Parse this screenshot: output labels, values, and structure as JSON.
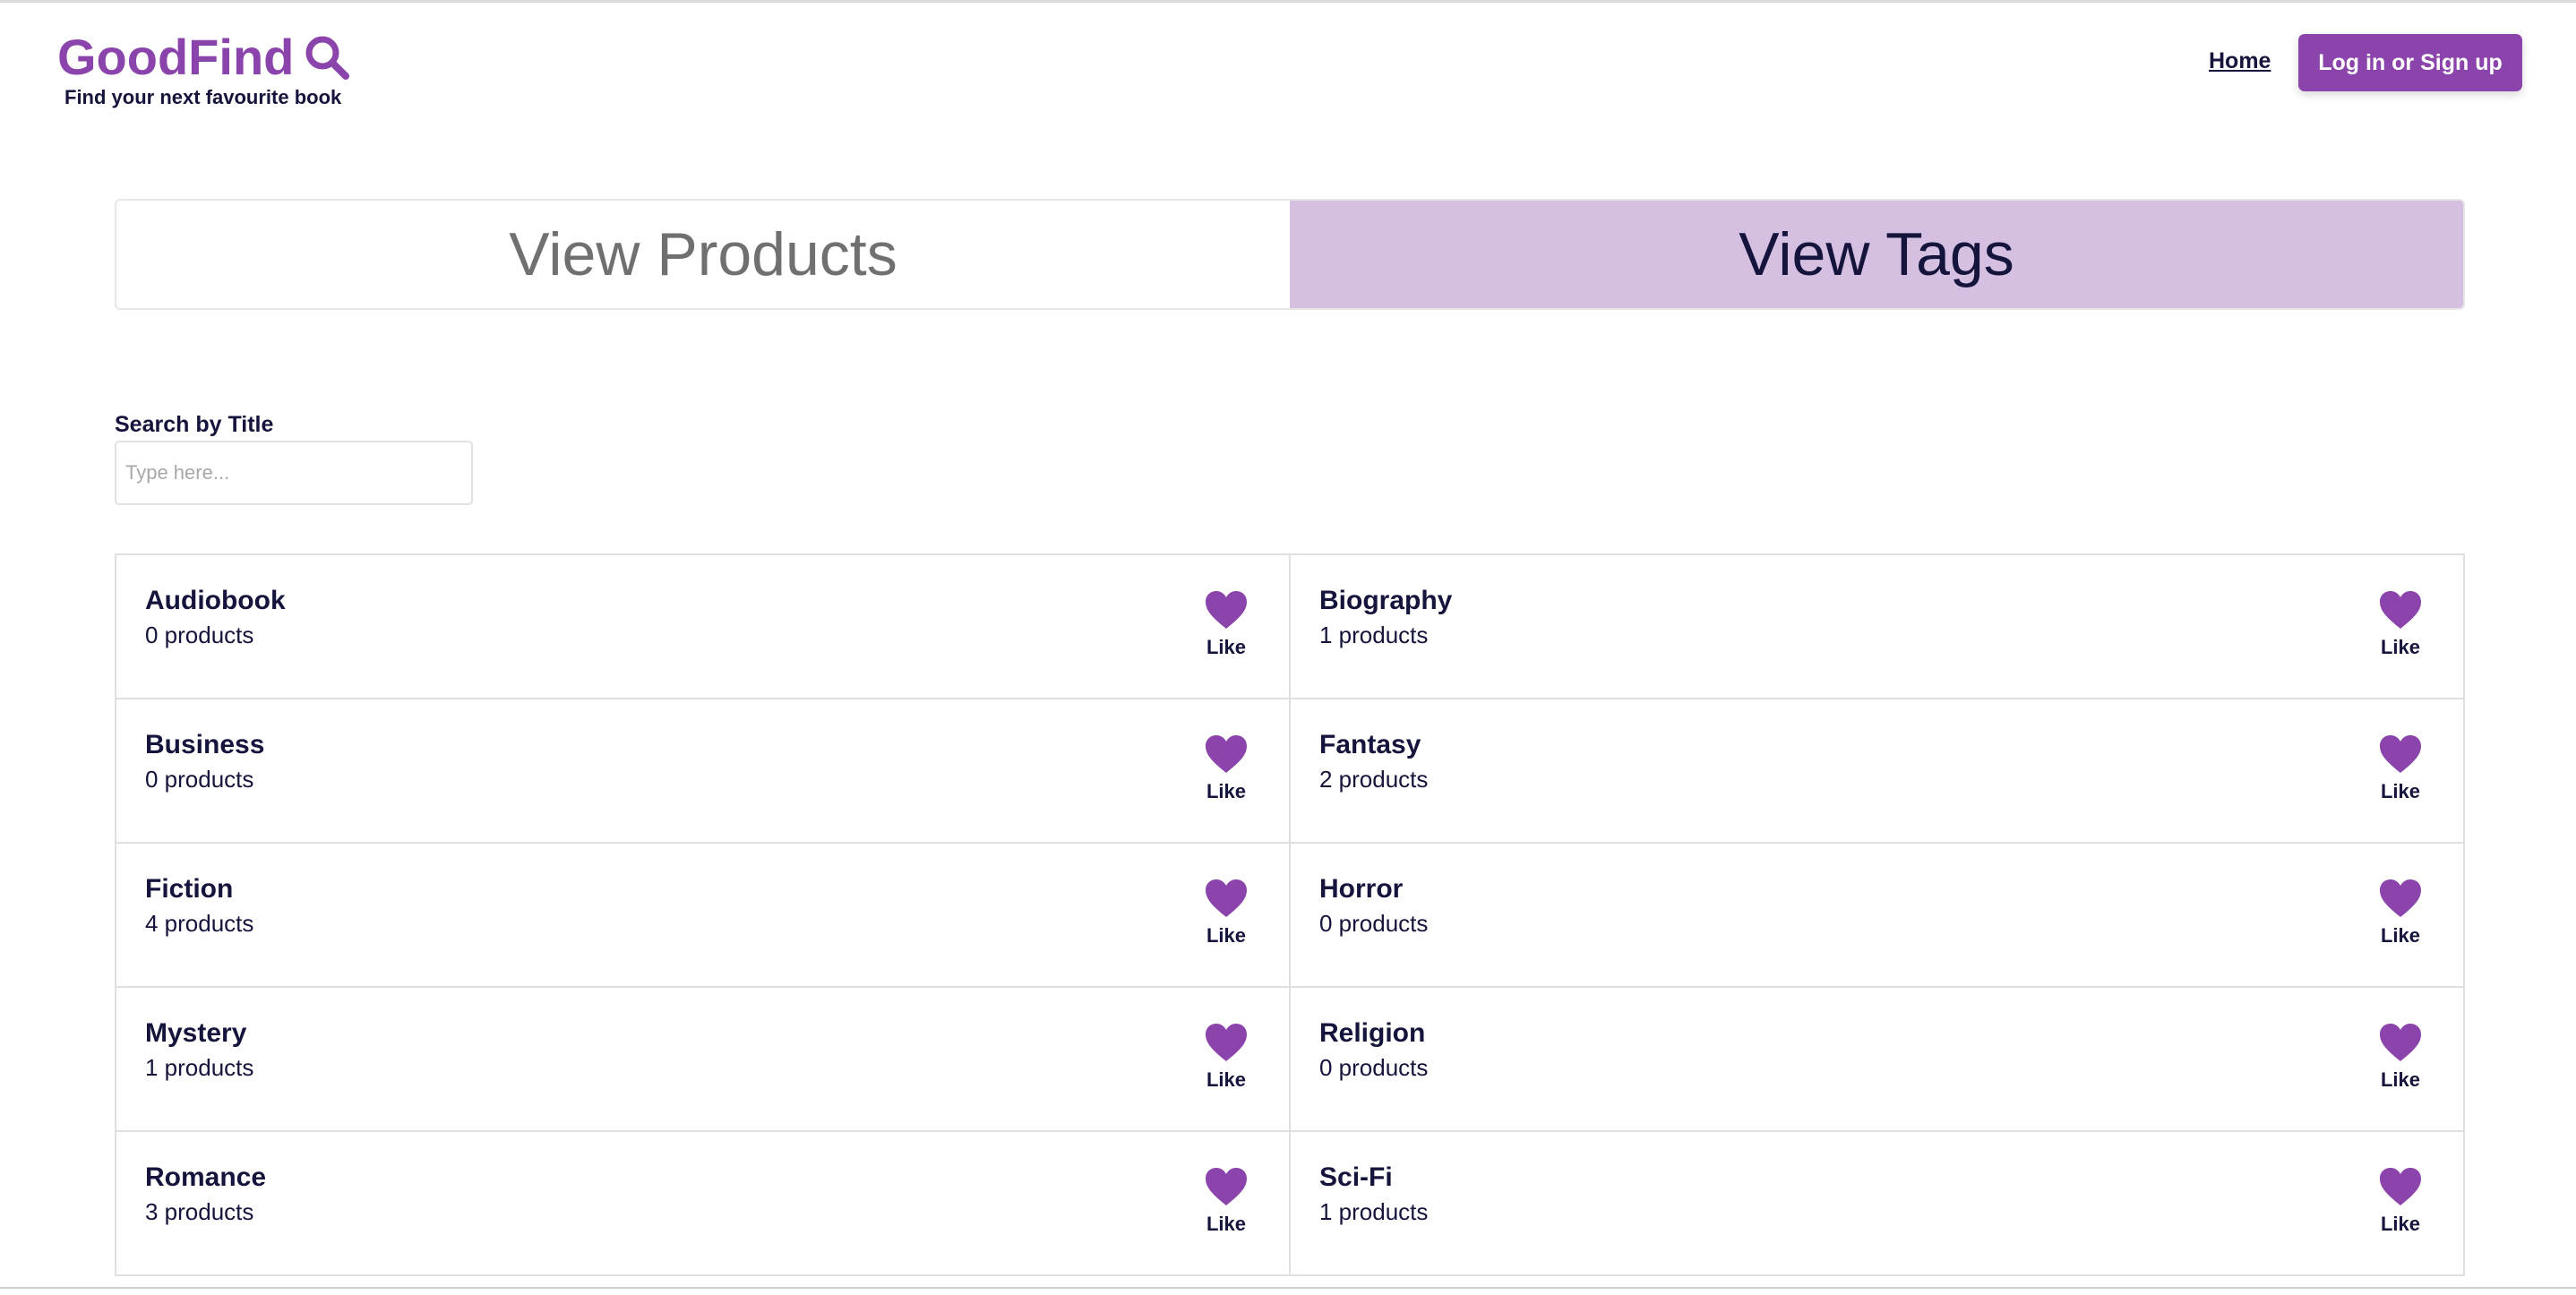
{
  "brand": {
    "name": "GoodFind",
    "tagline": "Find your next favourite book",
    "accent_color": "#8b44ac",
    "logo_icon": "search-icon"
  },
  "nav": {
    "home_label": "Home",
    "login_label": "Log in or Sign up"
  },
  "tabs": [
    {
      "label": "View Products",
      "active": false
    },
    {
      "label": "View Tags",
      "active": true
    }
  ],
  "search": {
    "label": "Search by Title",
    "placeholder": "Type here...",
    "value": ""
  },
  "tags": [
    {
      "name": "Audiobook",
      "count": "0 products",
      "like_label": "Like",
      "icon": "heart-icon"
    },
    {
      "name": "Biography",
      "count": "1 products",
      "like_label": "Like",
      "icon": "heart-icon"
    },
    {
      "name": "Business",
      "count": "0 products",
      "like_label": "Like",
      "icon": "heart-icon"
    },
    {
      "name": "Fantasy",
      "count": "2 products",
      "like_label": "Like",
      "icon": "heart-icon"
    },
    {
      "name": "Fiction",
      "count": "4 products",
      "like_label": "Like",
      "icon": "heart-icon"
    },
    {
      "name": "Horror",
      "count": "0 products",
      "like_label": "Like",
      "icon": "heart-icon"
    },
    {
      "name": "Mystery",
      "count": "1 products",
      "like_label": "Like",
      "icon": "heart-icon"
    },
    {
      "name": "Religion",
      "count": "0 products",
      "like_label": "Like",
      "icon": "heart-icon"
    },
    {
      "name": "Romance",
      "count": "3 products",
      "like_label": "Like",
      "icon": "heart-icon"
    },
    {
      "name": "Sci-Fi",
      "count": "1 products",
      "like_label": "Like",
      "icon": "heart-icon"
    }
  ]
}
